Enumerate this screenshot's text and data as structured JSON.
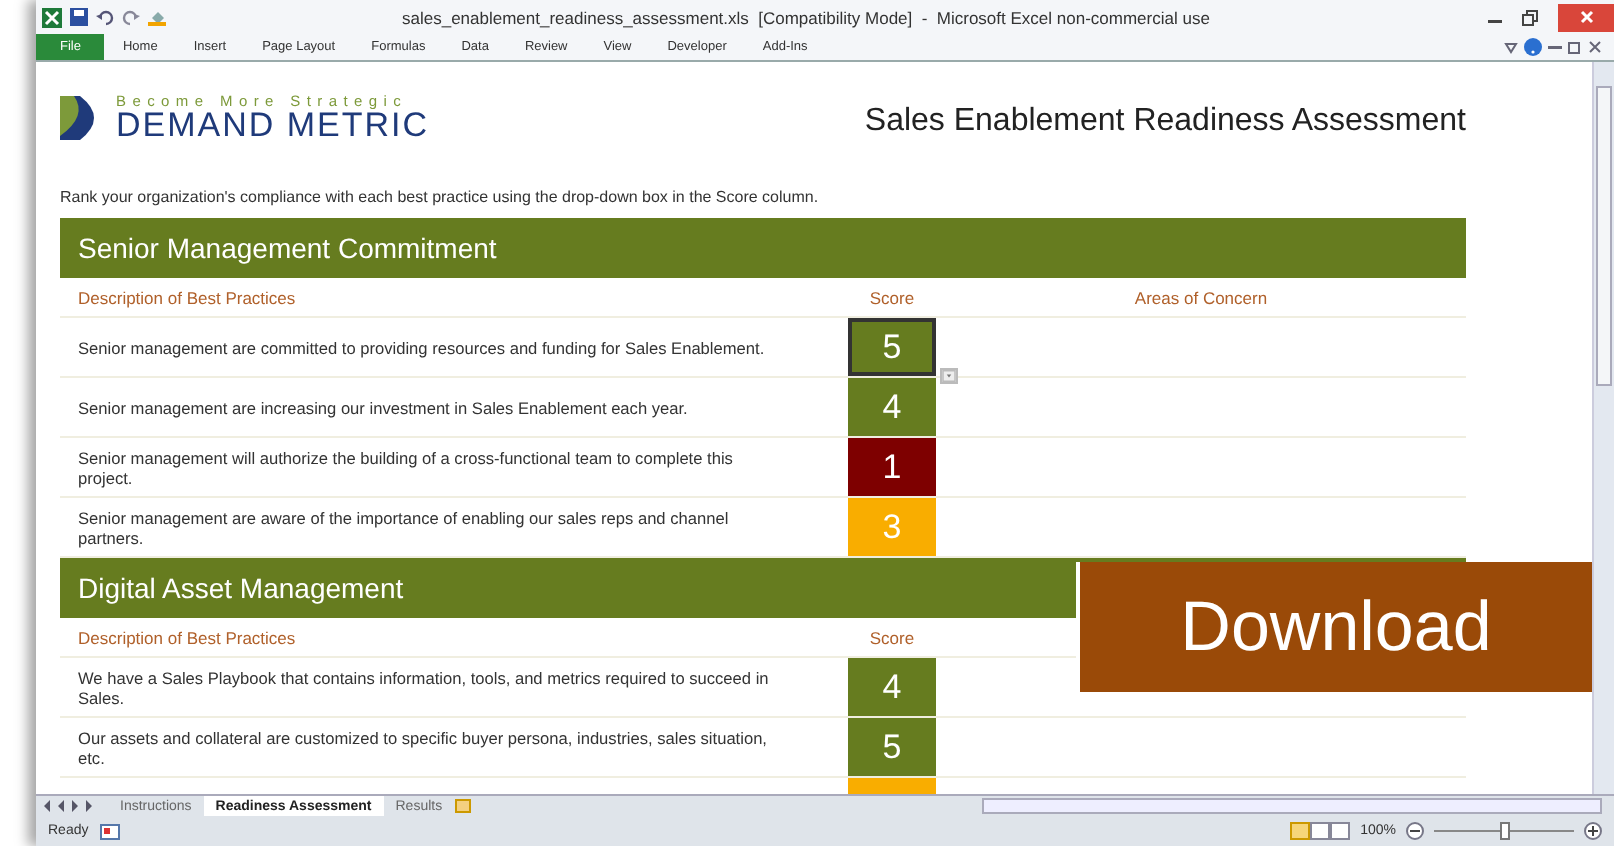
{
  "window": {
    "title": "sales_enablement_readiness_assessment.xls  [Compatibility Mode]  -  Microsoft Excel non-commercial use"
  },
  "ribbon_tabs": [
    {
      "label": "File",
      "selected": true
    },
    {
      "label": "Home",
      "selected": false
    },
    {
      "label": "Insert",
      "selected": false
    },
    {
      "label": "Page Layout",
      "selected": false
    },
    {
      "label": "Formulas",
      "selected": false
    },
    {
      "label": "Data",
      "selected": false
    },
    {
      "label": "Review",
      "selected": false
    },
    {
      "label": "View",
      "selected": false
    },
    {
      "label": "Developer",
      "selected": false
    },
    {
      "label": "Add-Ins",
      "selected": false
    }
  ],
  "logo": {
    "tagline": "Become More Strategic",
    "name": "DEMAND METRIC"
  },
  "sheet_title": "Sales Enablement Readiness Assessment",
  "instructions": "Rank your organization's compliance with each best practice using the drop-down box in the Score column.",
  "sections": [
    {
      "title": "Senior Management Commitment",
      "columns": [
        "Description of Best Practices",
        "Score",
        "Areas of Concern"
      ],
      "rows": [
        {
          "description": "Senior management are committed to providing resources and funding for Sales Enablement.",
          "score": "5",
          "color": "#667c1f",
          "selected": true
        },
        {
          "description": "Senior management are increasing our investment in Sales Enablement each year.",
          "score": "4",
          "color": "#667c1f",
          "selected": false
        },
        {
          "description": "Senior management will authorize the building of a cross-functional team to complete this project.",
          "score": "1",
          "color": "#7e0000",
          "selected": false
        },
        {
          "description": "Senior management are aware of the importance of enabling our sales reps and channel partners.",
          "score": "3",
          "color": "#f9ad00",
          "selected": false
        }
      ]
    },
    {
      "title": "Digital Asset Management",
      "columns": [
        "Description of Best Practices",
        "Score"
      ],
      "rows": [
        {
          "description": "We have a Sales Playbook that contains information, tools, and metrics required to succeed in Sales.",
          "score": "4",
          "color": "#667c1f",
          "selected": false
        },
        {
          "description": "Our assets and collateral are customized to specific buyer persona, industries, sales situation, etc.",
          "score": "5",
          "color": "#667c1f",
          "selected": false
        },
        {
          "color": "#f9ad00",
          "selected": false
        }
      ]
    }
  ],
  "download_banner": {
    "label": "Download"
  },
  "sheet_tabs": [
    {
      "label": "Instructions",
      "selected": false
    },
    {
      "label": "Readiness Assessment",
      "selected": true
    },
    {
      "label": "Results",
      "selected": false
    }
  ],
  "status_bar": {
    "status": "Ready",
    "zoom": "100%",
    "zoom_slider": {
      "level": 0.5
    }
  }
}
